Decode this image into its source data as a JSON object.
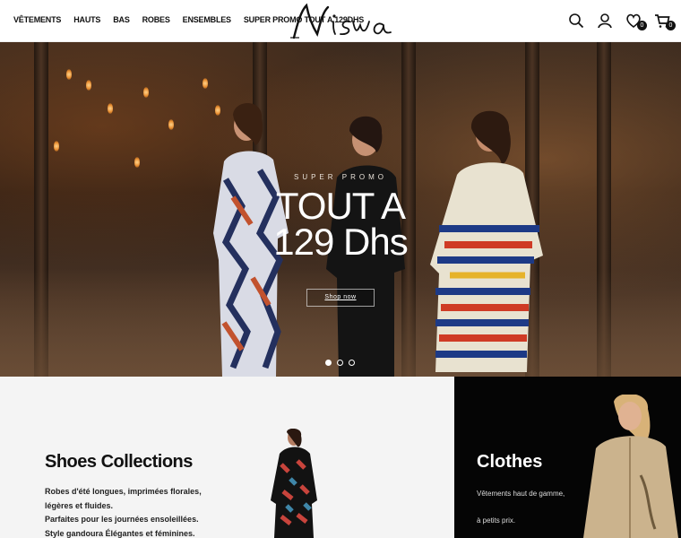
{
  "nav": {
    "items": [
      "VÊTEMENTS",
      "HAUTS",
      "BAS",
      "ROBES",
      "ENSEMBLES",
      "SUPER PROMO TOUT A 129DHS"
    ]
  },
  "logo": {
    "text": "Niswa"
  },
  "header_icons": {
    "search": "search-icon",
    "account": "user-icon",
    "wishlist": "heart-icon",
    "wishlist_count": "0",
    "cart": "cart-icon",
    "cart_count": "0"
  },
  "hero": {
    "kicker": "SUPER PROMO",
    "headline_line1": "TOUT A",
    "headline_line2": "129 Dhs",
    "cta_label": "Shop now",
    "slides": 3,
    "active_slide": 1
  },
  "collections": {
    "shoes": {
      "title": "Shoes Collections",
      "lines": [
        "Robes d'été longues, imprimées florales,",
        "légères et fluides.",
        "Parfaites pour les journées ensoleillées.",
        "Style gandoura Élégantes et féminines."
      ]
    },
    "clothes": {
      "title": "Clothes",
      "lines": [
        "Vêtements haut de gamme,",
        "à petits prix."
      ]
    }
  },
  "colors": {
    "accent": "#111111",
    "lower_left_bg": "#f4f4f4",
    "lower_right_bg": "#050505"
  }
}
